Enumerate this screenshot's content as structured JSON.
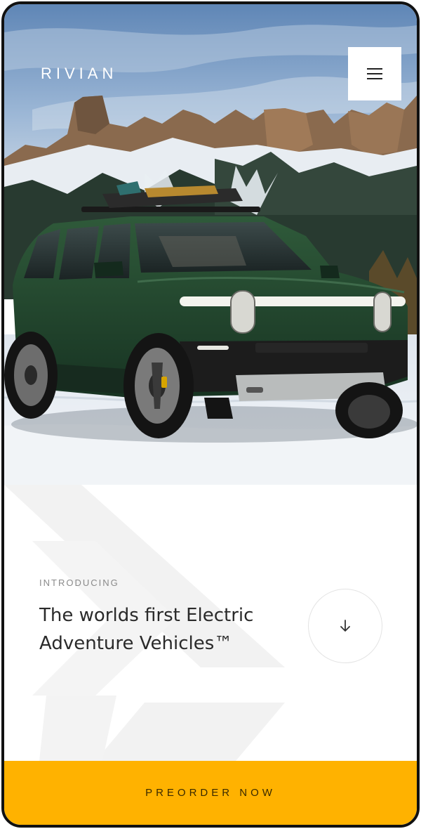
{
  "header": {
    "brand_logo": "RIVIAN",
    "menu_icon": "hamburger-icon"
  },
  "hero": {
    "image": "green-suv-in-snowy-mountains"
  },
  "intro": {
    "eyebrow": "INTRODUCING",
    "headline": "The worlds first Electric Adventure Vehicles™",
    "scroll_icon": "arrow-down-icon"
  },
  "cta": {
    "label": "PREORDER NOW"
  },
  "colors": {
    "accent": "#ffb200",
    "vehicle": "#23452c",
    "sky": "#7fa3cc",
    "snow": "#eef2f6"
  }
}
